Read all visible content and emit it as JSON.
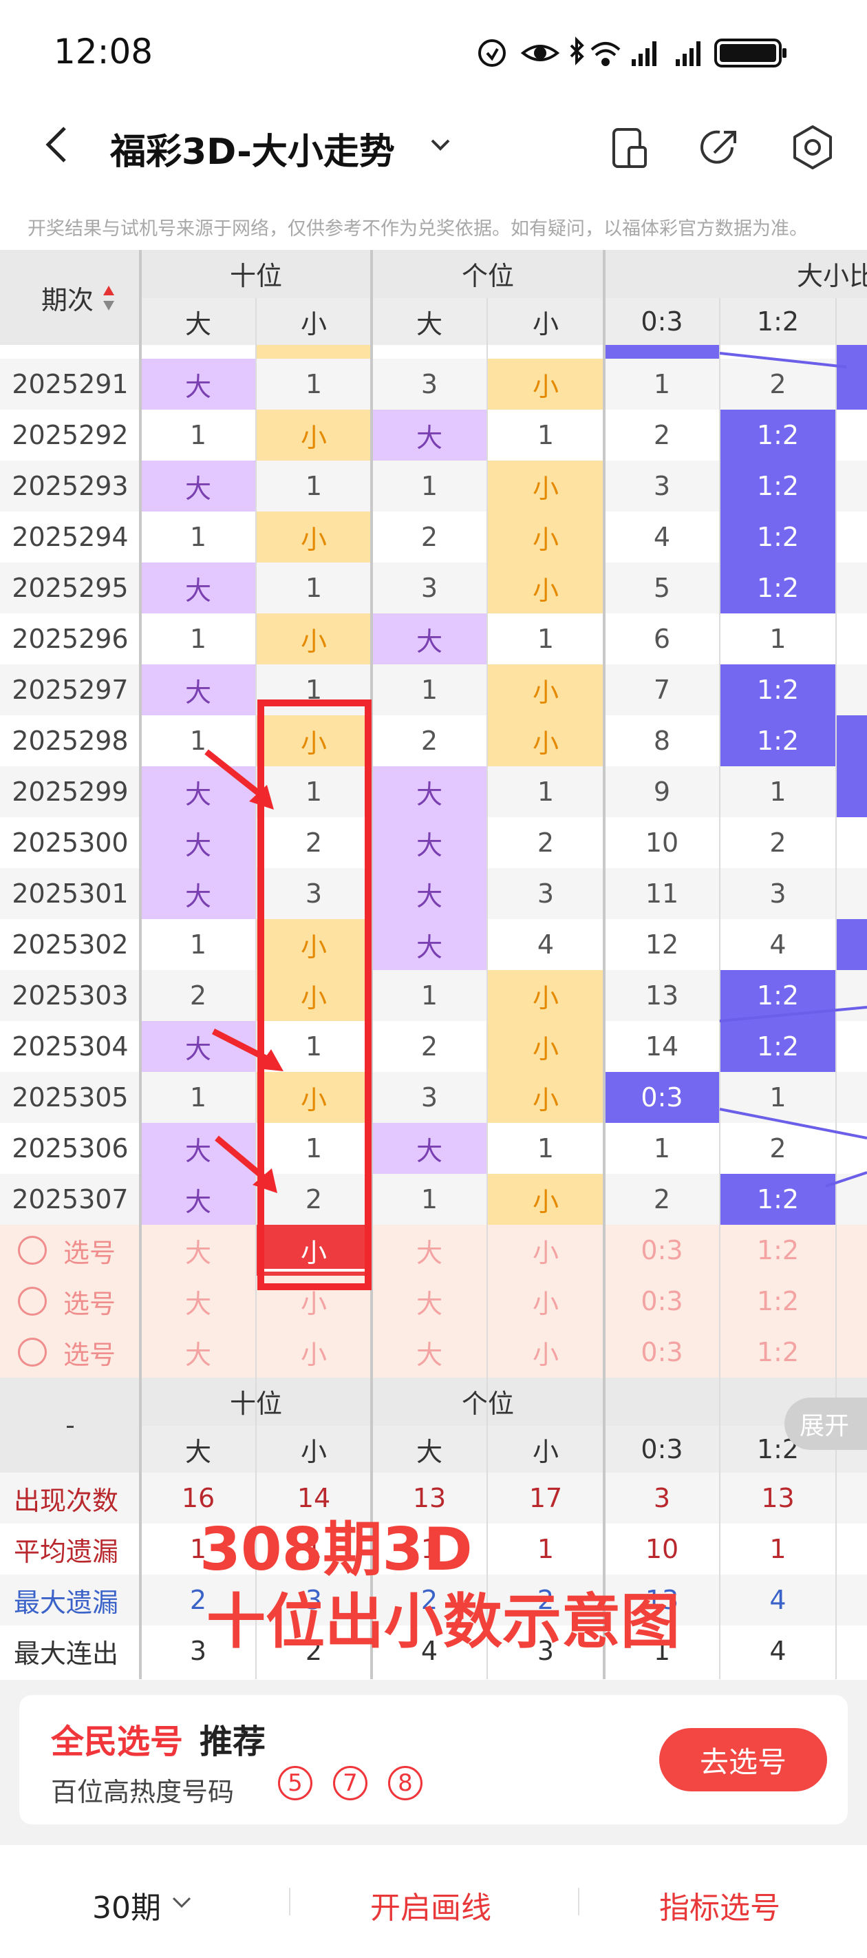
{
  "status_bar": {
    "time": "12:08"
  },
  "header": {
    "title": "福彩3D-大小走势"
  },
  "disclaimer": "开奖结果与试机号来源于网络，仅供参考不作为兑奖依据。如有疑问，以福体彩官方数据为准。",
  "table": {
    "period_header": "期次",
    "group_headers": [
      "十位",
      "个位",
      "大小比"
    ],
    "sub_headers": [
      "大",
      "小",
      "大",
      "小",
      "0:3",
      "1:2"
    ],
    "rows": [
      {
        "period": "2025291",
        "ten_big": "大",
        "ten_small": "1",
        "one_big": "3",
        "one_small": "小",
        "r03": "1",
        "r12": "2"
      },
      {
        "period": "2025292",
        "ten_big": "1",
        "ten_small": "小",
        "one_big": "大",
        "one_small": "1",
        "r03": "2",
        "r12": "1:2"
      },
      {
        "period": "2025293",
        "ten_big": "大",
        "ten_small": "1",
        "one_big": "1",
        "one_small": "小",
        "r03": "3",
        "r12": "1:2"
      },
      {
        "period": "2025294",
        "ten_big": "1",
        "ten_small": "小",
        "one_big": "2",
        "one_small": "小",
        "r03": "4",
        "r12": "1:2"
      },
      {
        "period": "2025295",
        "ten_big": "大",
        "ten_small": "1",
        "one_big": "3",
        "one_small": "小",
        "r03": "5",
        "r12": "1:2"
      },
      {
        "period": "2025296",
        "ten_big": "1",
        "ten_small": "小",
        "one_big": "大",
        "one_small": "1",
        "r03": "6",
        "r12": "1"
      },
      {
        "period": "2025297",
        "ten_big": "大",
        "ten_small": "1",
        "one_big": "1",
        "one_small": "小",
        "r03": "7",
        "r12": "1:2"
      },
      {
        "period": "2025298",
        "ten_big": "1",
        "ten_small": "小",
        "one_big": "2",
        "one_small": "小",
        "r03": "8",
        "r12": "1:2"
      },
      {
        "period": "2025299",
        "ten_big": "大",
        "ten_small": "1",
        "one_big": "大",
        "one_small": "1",
        "r03": "9",
        "r12": "1"
      },
      {
        "period": "2025300",
        "ten_big": "大",
        "ten_small": "2",
        "one_big": "大",
        "one_small": "2",
        "r03": "10",
        "r12": "2"
      },
      {
        "period": "2025301",
        "ten_big": "大",
        "ten_small": "3",
        "one_big": "大",
        "one_small": "3",
        "r03": "11",
        "r12": "3"
      },
      {
        "period": "2025302",
        "ten_big": "1",
        "ten_small": "小",
        "one_big": "大",
        "one_small": "4",
        "r03": "12",
        "r12": "4"
      },
      {
        "period": "2025303",
        "ten_big": "2",
        "ten_small": "小",
        "one_big": "1",
        "one_small": "小",
        "r03": "13",
        "r12": "1:2"
      },
      {
        "period": "2025304",
        "ten_big": "大",
        "ten_small": "1",
        "one_big": "2",
        "one_small": "小",
        "r03": "14",
        "r12": "1:2"
      },
      {
        "period": "2025305",
        "ten_big": "1",
        "ten_small": "小",
        "one_big": "3",
        "one_small": "小",
        "r03": "0:3",
        "r12": "1"
      },
      {
        "period": "2025306",
        "ten_big": "大",
        "ten_small": "1",
        "one_big": "大",
        "one_small": "1",
        "r03": "1",
        "r12": "2"
      },
      {
        "period": "2025307",
        "ten_big": "大",
        "ten_small": "2",
        "one_big": "1",
        "one_small": "小",
        "r03": "2",
        "r12": "1:2"
      }
    ],
    "select_rows": [
      {
        "label": "选号",
        "cells": [
          "大",
          "小",
          "大",
          "小",
          "0:3",
          "1:2"
        ]
      },
      {
        "label": "选号",
        "cells": [
          "大",
          "小",
          "大",
          "小",
          "0:3",
          "1:2"
        ]
      },
      {
        "label": "选号",
        "cells": [
          "大",
          "小",
          "大",
          "小",
          "0:3",
          "1:2"
        ]
      }
    ],
    "footer_dash": "-",
    "stats": [
      {
        "label": "出现次数",
        "color": "#b8282d",
        "values": [
          "16",
          "14",
          "13",
          "17",
          "3",
          "13"
        ]
      },
      {
        "label": "平均遗漏",
        "color": "#b8282d",
        "values": [
          "1",
          "1",
          "1",
          "1",
          "10",
          "1"
        ]
      },
      {
        "label": "最大遗漏",
        "color": "#3a62c8",
        "values": [
          "2",
          "3",
          "2",
          "2",
          "13",
          "4"
        ]
      },
      {
        "label": "最大连出",
        "color": "#333333",
        "values": [
          "3",
          "2",
          "4",
          "3",
          "1",
          "4"
        ]
      }
    ]
  },
  "expand_button": "展开",
  "annotation": {
    "line1": "308期3D",
    "line2": "十位出小数示意图"
  },
  "recommend": {
    "title_red": "全民选号",
    "title_black": "推荐",
    "subtitle": "百位高热度号码",
    "numbers": [
      "5",
      "7",
      "8"
    ],
    "go_button": "去选号"
  },
  "bottom_bar": {
    "period": "30期",
    "draw_line": "开启画线",
    "indicator": "指标选号"
  },
  "colors": {
    "big_bg": "#e2c8ff",
    "small_bg": "#fde2a2",
    "small_text": "#e58a00",
    "big_text": "#7a3fb0",
    "ratio_bg": "#7467f0",
    "accent_red": "#f0363a",
    "select_bg": "#fdece4"
  }
}
